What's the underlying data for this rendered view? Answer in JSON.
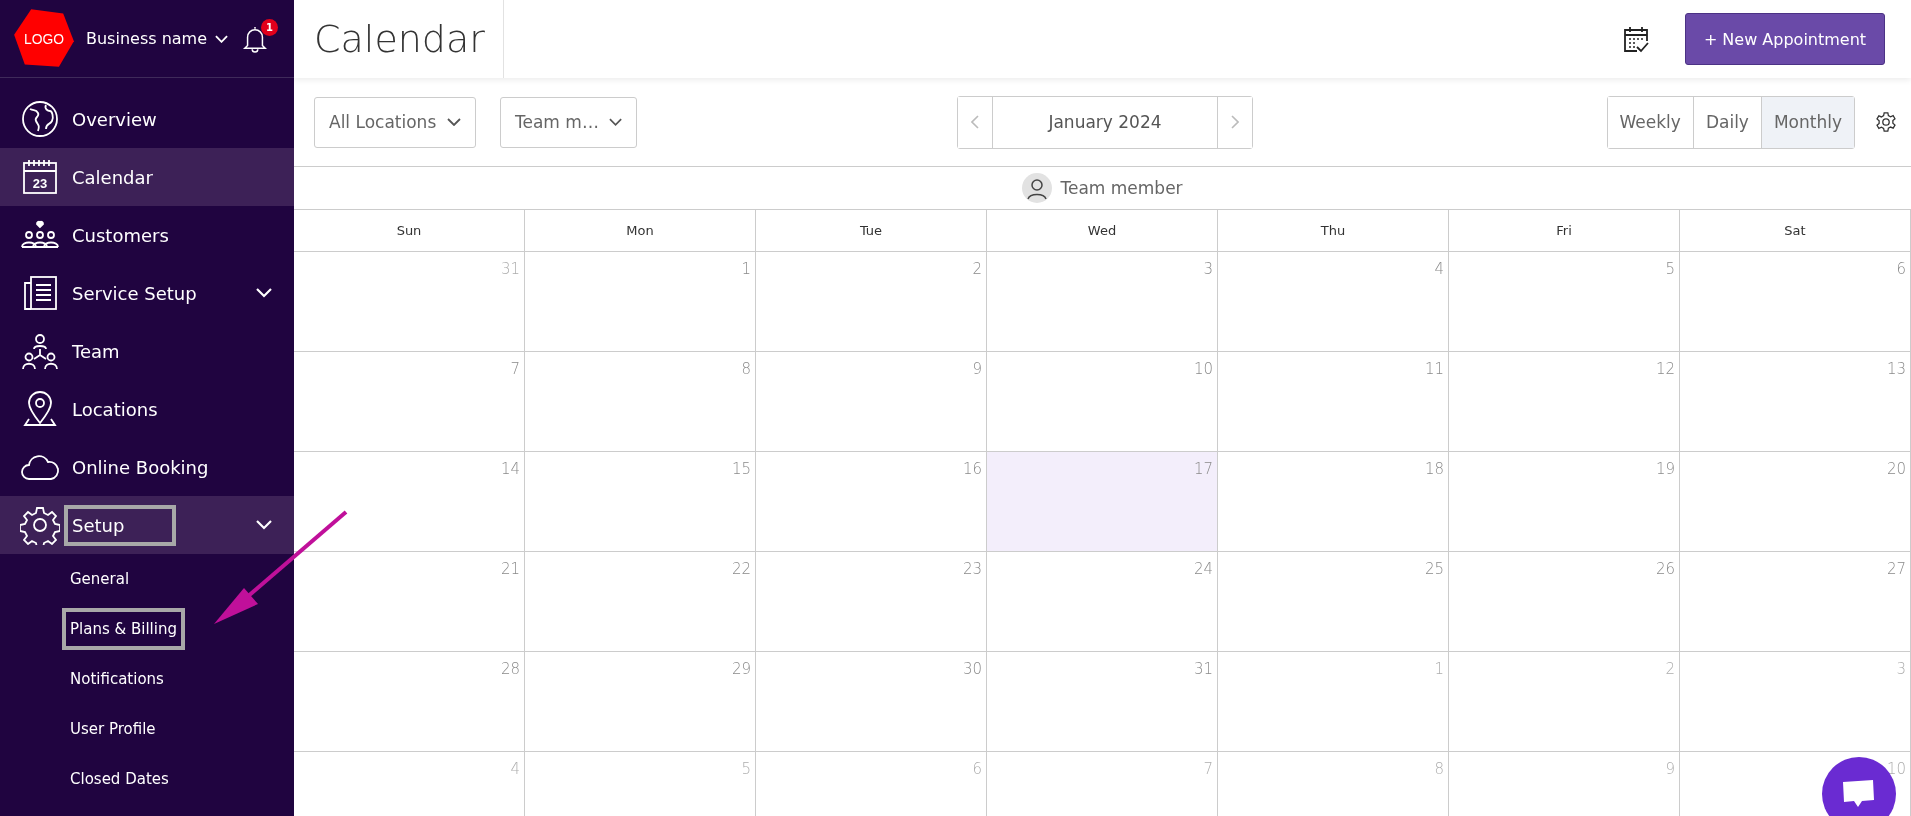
{
  "sidebar": {
    "logo": "LOGO",
    "business_name": "Business name",
    "notification_count": "1",
    "items": [
      {
        "label": "Overview",
        "selected": false
      },
      {
        "label": "Calendar",
        "selected": true,
        "icon_text": "23"
      },
      {
        "label": "Customers",
        "selected": false
      },
      {
        "label": "Service Setup",
        "selected": false,
        "has_submenu": true
      },
      {
        "label": "Team",
        "selected": false
      },
      {
        "label": "Locations",
        "selected": false
      },
      {
        "label": "Online Booking",
        "selected": false
      },
      {
        "label": "Setup",
        "selected": true,
        "has_submenu": true,
        "highlighted": true,
        "children": [
          {
            "label": "General",
            "highlighted": false
          },
          {
            "label": "Plans & Billing",
            "highlighted": true
          },
          {
            "label": "Notifications",
            "highlighted": false
          },
          {
            "label": "User Profile",
            "highlighted": false
          },
          {
            "label": "Closed Dates",
            "highlighted": false
          }
        ]
      }
    ]
  },
  "header": {
    "title": "Calendar",
    "new_button": "+ New Appointment"
  },
  "filters": [
    {
      "label": "All Locations"
    },
    {
      "label": "Team m…"
    }
  ],
  "date_nav": {
    "label": "January 2024"
  },
  "views": [
    {
      "label": "Weekly",
      "selected": false
    },
    {
      "label": "Daily",
      "selected": false
    },
    {
      "label": "Monthly",
      "selected": true
    }
  ],
  "calendar": {
    "team_member": "Team member",
    "days": [
      "Sun",
      "Mon",
      "Tue",
      "Wed",
      "Thu",
      "Fri",
      "Sat"
    ],
    "weeks": [
      [
        {
          "date": "31",
          "muted": true
        },
        {
          "date": "1",
          "muted": false
        },
        {
          "date": "2",
          "muted": false
        },
        {
          "date": "3",
          "muted": false
        },
        {
          "date": "4",
          "muted": false
        },
        {
          "date": "5",
          "muted": false
        },
        {
          "date": "6",
          "muted": false
        }
      ],
      [
        {
          "date": "7",
          "muted": false
        },
        {
          "date": "8",
          "muted": false
        },
        {
          "date": "9",
          "muted": false
        },
        {
          "date": "10",
          "muted": false
        },
        {
          "date": "11",
          "muted": false
        },
        {
          "date": "12",
          "muted": false
        },
        {
          "date": "13",
          "muted": false
        }
      ],
      [
        {
          "date": "14",
          "muted": false
        },
        {
          "date": "15",
          "muted": false
        },
        {
          "date": "16",
          "muted": false
        },
        {
          "date": "17",
          "muted": false,
          "today": true
        },
        {
          "date": "18",
          "muted": false
        },
        {
          "date": "19",
          "muted": false
        },
        {
          "date": "20",
          "muted": false
        }
      ],
      [
        {
          "date": "21",
          "muted": false
        },
        {
          "date": "22",
          "muted": false
        },
        {
          "date": "23",
          "muted": false
        },
        {
          "date": "24",
          "muted": false
        },
        {
          "date": "25",
          "muted": false
        },
        {
          "date": "26",
          "muted": false
        },
        {
          "date": "27",
          "muted": false
        }
      ],
      [
        {
          "date": "28",
          "muted": false
        },
        {
          "date": "29",
          "muted": false
        },
        {
          "date": "30",
          "muted": false
        },
        {
          "date": "31",
          "muted": false
        },
        {
          "date": "1",
          "muted": true
        },
        {
          "date": "2",
          "muted": true
        },
        {
          "date": "3",
          "muted": true
        }
      ],
      [
        {
          "date": "4",
          "muted": true
        },
        {
          "date": "5",
          "muted": true
        },
        {
          "date": "6",
          "muted": true
        },
        {
          "date": "7",
          "muted": true
        },
        {
          "date": "8",
          "muted": true
        },
        {
          "date": "9",
          "muted": true
        },
        {
          "date": "10",
          "muted": true
        }
      ]
    ]
  }
}
